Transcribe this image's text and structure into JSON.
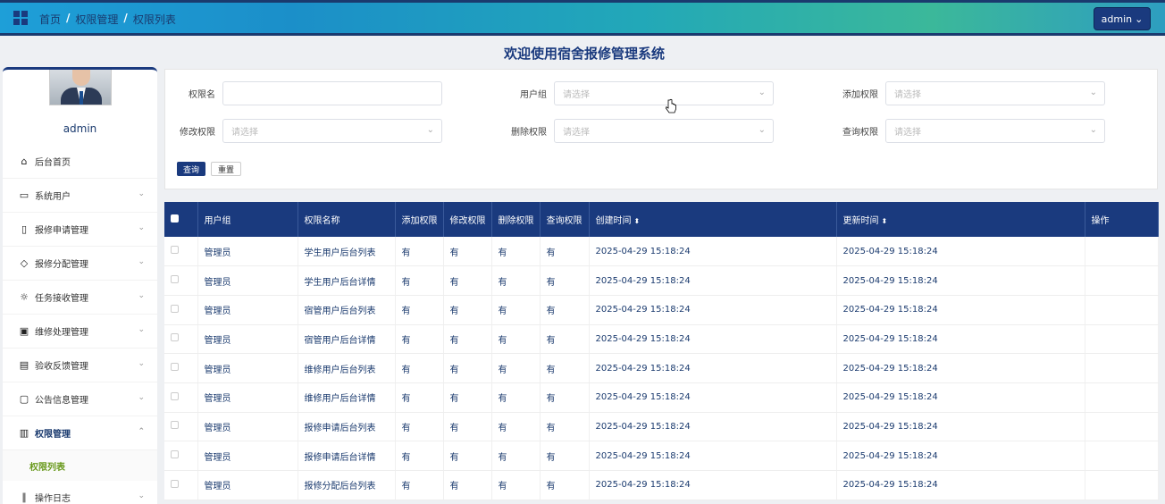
{
  "header": {
    "breadcrumb": [
      "首页",
      "权限管理",
      "权限列表"
    ],
    "admin_label": "admin"
  },
  "sidebar": {
    "username": "admin",
    "items": [
      {
        "label": "后台首页",
        "icon": "home-icon"
      },
      {
        "label": "系统用户",
        "icon": "monitor-icon"
      },
      {
        "label": "报修申请管理",
        "icon": "bookmark-icon"
      },
      {
        "label": "报修分配管理",
        "icon": "tag-icon"
      },
      {
        "label": "任务接收管理",
        "icon": "sun-icon"
      },
      {
        "label": "维修处理管理",
        "icon": "inbox-icon"
      },
      {
        "label": "验收反馈管理",
        "icon": "clipboard-icon"
      },
      {
        "label": "公告信息管理",
        "icon": "message-icon"
      },
      {
        "label": "权限管理",
        "icon": "archive-icon"
      }
    ],
    "active_sub": "权限列表",
    "last_item": {
      "label": "操作日志",
      "icon": "paperclip-icon"
    }
  },
  "main": {
    "title": "欢迎使用宿舍报修管理系统"
  },
  "filter": {
    "fields": [
      {
        "label": "权限名",
        "placeholder": ""
      },
      {
        "label": "用户组",
        "placeholder": "请选择"
      },
      {
        "label": "添加权限",
        "placeholder": "请选择"
      },
      {
        "label": "修改权限",
        "placeholder": "请选择"
      },
      {
        "label": "删除权限",
        "placeholder": "请选择"
      },
      {
        "label": "查询权限",
        "placeholder": "请选择"
      }
    ],
    "query_label": "查询",
    "reset_label": "重置"
  },
  "table": {
    "columns": [
      "用户组",
      "权限名称",
      "添加权限",
      "修改权限",
      "删除权限",
      "查询权限",
      "创建时间",
      "更新时间",
      "操作"
    ],
    "rows": [
      [
        "管理员",
        "学生用户后台列表",
        "有",
        "有",
        "有",
        "有",
        "2025-04-29 15:18:24",
        "2025-04-29 15:18:24"
      ],
      [
        "管理员",
        "学生用户后台详情",
        "有",
        "有",
        "有",
        "有",
        "2025-04-29 15:18:24",
        "2025-04-29 15:18:24"
      ],
      [
        "管理员",
        "宿管用户后台列表",
        "有",
        "有",
        "有",
        "有",
        "2025-04-29 15:18:24",
        "2025-04-29 15:18:24"
      ],
      [
        "管理员",
        "宿管用户后台详情",
        "有",
        "有",
        "有",
        "有",
        "2025-04-29 15:18:24",
        "2025-04-29 15:18:24"
      ],
      [
        "管理员",
        "维修用户后台列表",
        "有",
        "有",
        "有",
        "有",
        "2025-04-29 15:18:24",
        "2025-04-29 15:18:24"
      ],
      [
        "管理员",
        "维修用户后台详情",
        "有",
        "有",
        "有",
        "有",
        "2025-04-29 15:18:24",
        "2025-04-29 15:18:24"
      ],
      [
        "管理员",
        "报修申请后台列表",
        "有",
        "有",
        "有",
        "有",
        "2025-04-29 15:18:24",
        "2025-04-29 15:18:24"
      ],
      [
        "管理员",
        "报修申请后台详情",
        "有",
        "有",
        "有",
        "有",
        "2025-04-29 15:18:24",
        "2025-04-29 15:18:24"
      ],
      [
        "管理员",
        "报修分配后台列表",
        "有",
        "有",
        "有",
        "有",
        "2025-04-29 15:18:24",
        "2025-04-29 15:18:24"
      ]
    ]
  }
}
